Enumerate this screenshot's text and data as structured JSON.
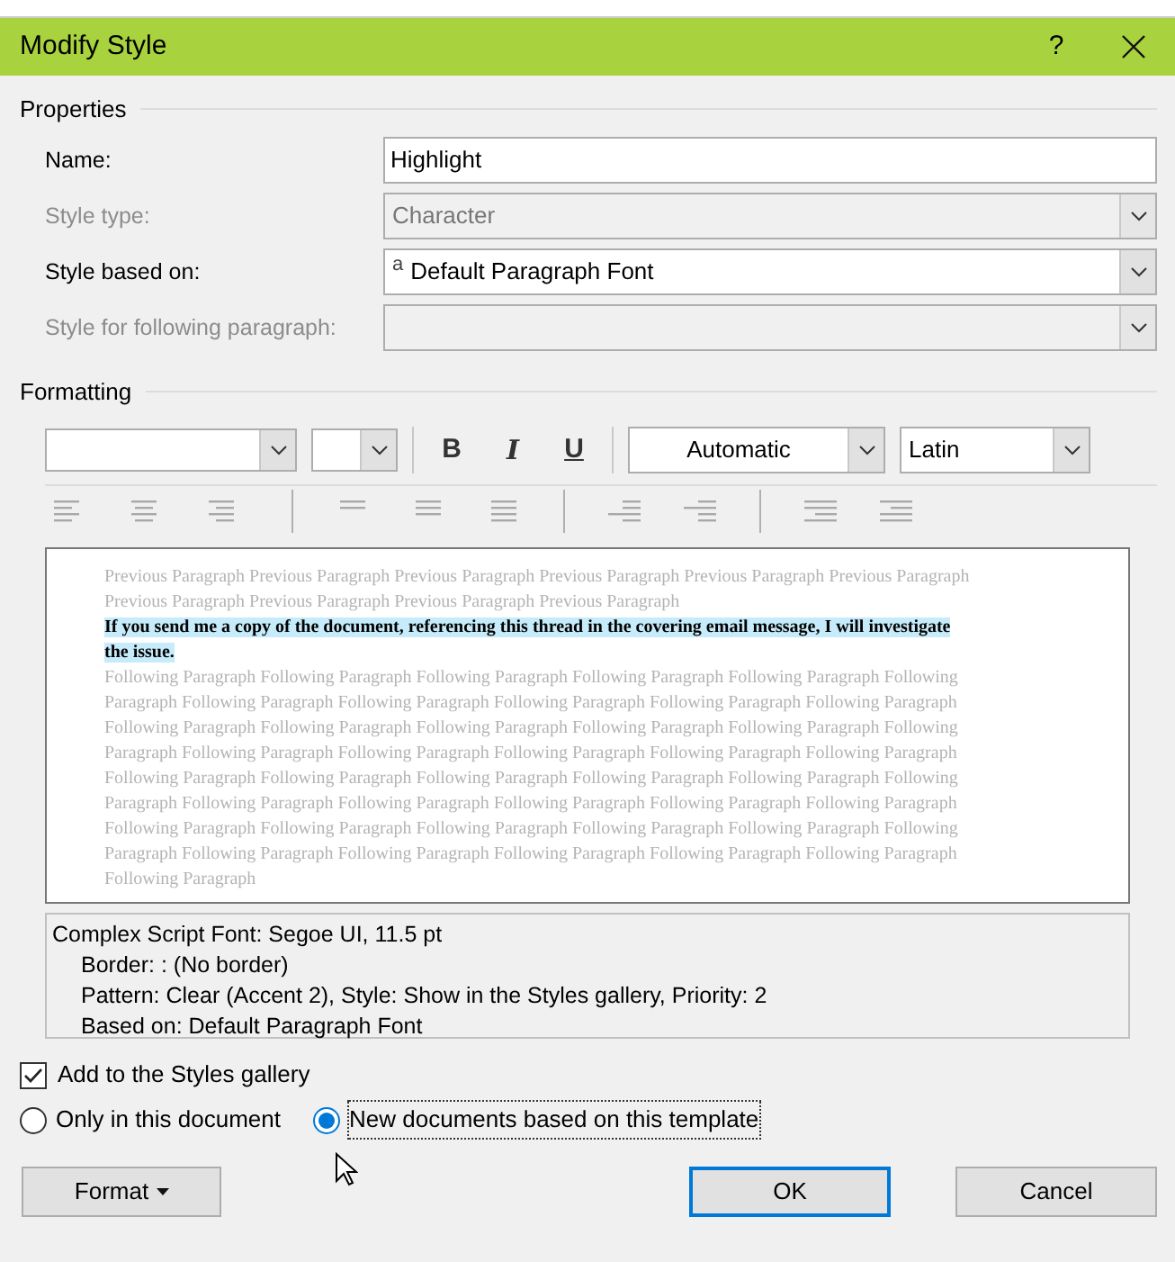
{
  "window": {
    "title": "Modify Style",
    "help": "?"
  },
  "properties": {
    "heading": "Properties",
    "rows": [
      {
        "label": "Name:",
        "kind": "text",
        "value": "Highlight"
      },
      {
        "label": "Style type:",
        "kind": "dropdown",
        "value": "Character",
        "disabled": true
      },
      {
        "label": "Style based on:",
        "kind": "dropdown",
        "value": "Default Paragraph Font",
        "prefix": "a",
        "disabled": false
      },
      {
        "label": "Style for following paragraph:",
        "kind": "dropdown",
        "disabled": true
      }
    ]
  },
  "formatting": {
    "heading": "Formatting",
    "bold": "B",
    "italic": "I",
    "underline": "U",
    "font_color_choice": "Automatic",
    "script": "Latin"
  },
  "preview": {
    "previous": "Previous Paragraph Previous Paragraph Previous Paragraph Previous Paragraph Previous Paragraph Previous Paragraph Previous Paragraph Previous Paragraph Previous Paragraph Previous Paragraph",
    "sample_lines": [
      "If you send me a copy of the document, referencing this thread in the covering email message, I will investigate",
      "the issue."
    ],
    "following": "Following Paragraph Following Paragraph Following Paragraph Following Paragraph Following Paragraph Following Paragraph Following Paragraph Following Paragraph Following Paragraph Following Paragraph Following Paragraph Following Paragraph Following Paragraph Following Paragraph Following Paragraph Following Paragraph Following Paragraph Following Paragraph Following Paragraph Following Paragraph Following Paragraph Following Paragraph Following Paragraph Following Paragraph Following Paragraph Following Paragraph Following Paragraph Following Paragraph Following Paragraph Following Paragraph Following Paragraph Following Paragraph Following Paragraph Following Paragraph Following Paragraph Following Paragraph Following Paragraph Following Paragraph Following Paragraph Following Paragraph Following Paragraph Following Paragraph Following Paragraph Following Paragraph Following Paragraph"
  },
  "description": [
    "Complex Script Font: Segoe UI, 11.5 pt",
    "Border: : (No border)",
    "Pattern: Clear (Accent 2), Style: Show in the Styles gallery, Priority: 2",
    "Based on: Default Paragraph Font"
  ],
  "add_to_gallery": {
    "label": "Add to the Styles gallery",
    "checked": true
  },
  "scope": [
    {
      "label": "Only in this document",
      "selected": false
    },
    {
      "label": "New documents based on this template",
      "selected": true
    }
  ],
  "buttons": [
    {
      "label": "Format",
      "kind": "menu"
    },
    {
      "label": "OK",
      "kind": "default"
    },
    {
      "label": "Cancel",
      "kind": "normal"
    }
  ]
}
